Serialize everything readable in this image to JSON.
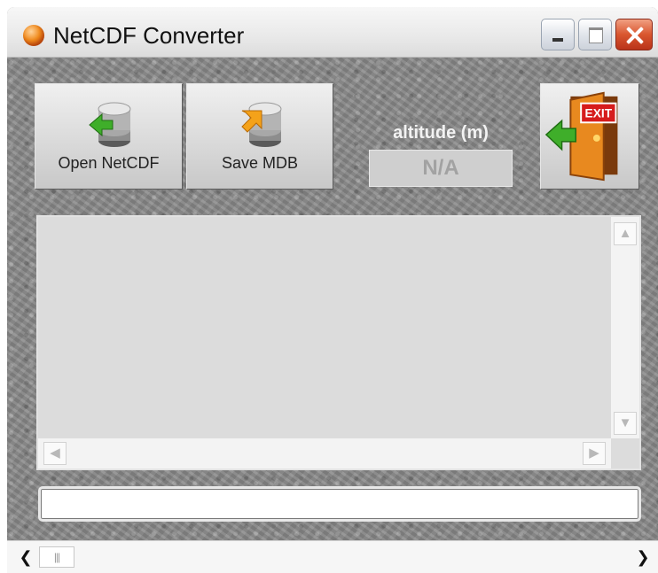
{
  "window": {
    "title": "NetCDF Converter",
    "title_icon": "app-orb-icon",
    "controls": [
      "minimize-icon",
      "maximize-icon",
      "close-icon"
    ]
  },
  "toolbar": {
    "open_label": "Open NetCDF",
    "open_icon": "database-import-icon",
    "save_label": "Save MDB",
    "save_icon": "database-export-icon",
    "exit_icon": "exit-door-icon",
    "exit_sign": "EXIT"
  },
  "altitude": {
    "label": "altitude (m)",
    "value": "N/A"
  },
  "colors": {
    "panel_background": "#8a8a8a",
    "listbox_background": "#dcdcdc",
    "altitude_text": "#f2f2f2"
  }
}
